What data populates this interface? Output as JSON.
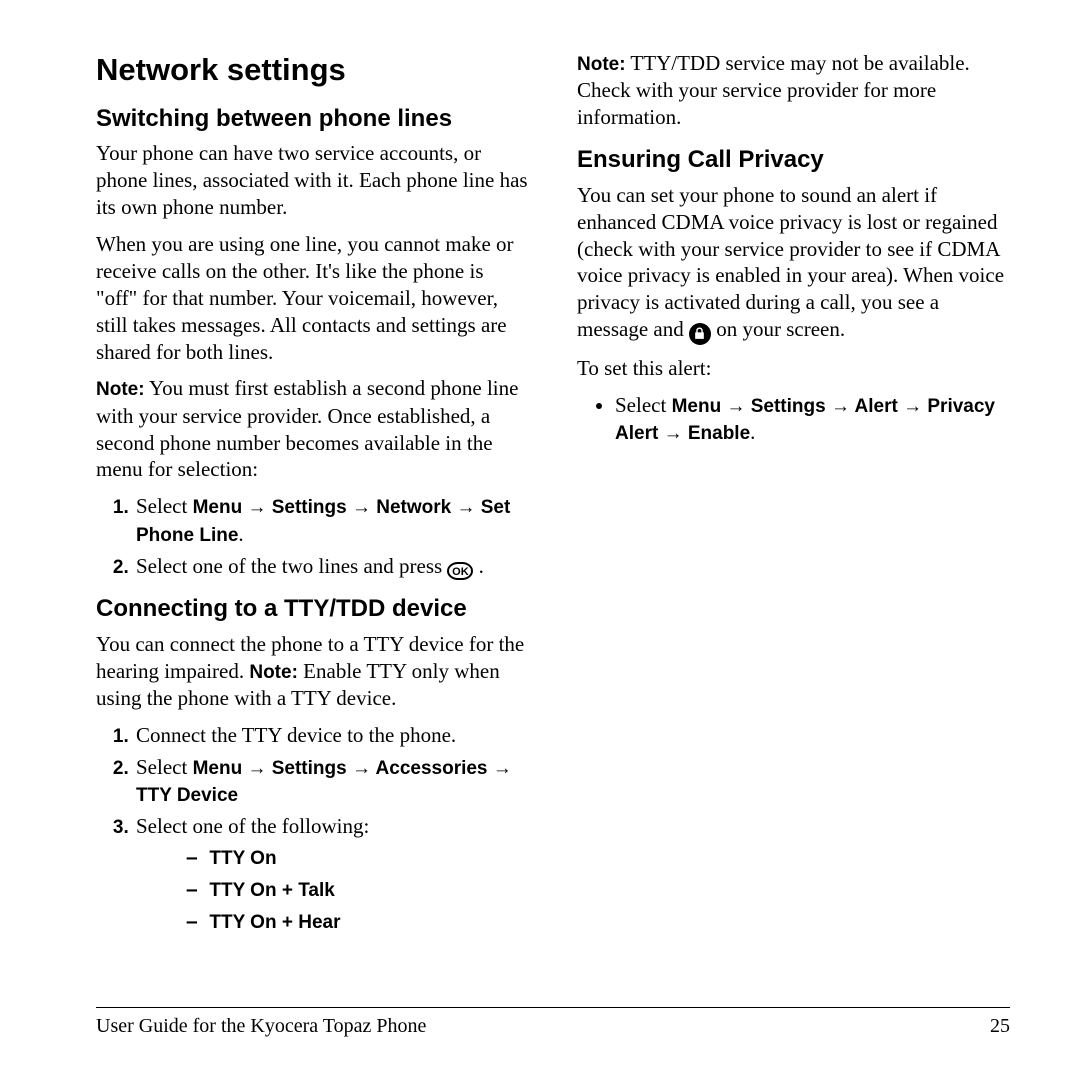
{
  "h1": "Network settings",
  "switching": {
    "heading": "Switching between phone lines",
    "p1": "Your phone can have two service accounts, or phone lines, associated with it. Each phone line has its own phone number.",
    "p2": "When you are using one line, you cannot make or receive calls on the other. It's like the phone is \"off\" for that number. Your voicemail, however, still takes messages. All contacts and settings are shared for both lines.",
    "note_label": "Note:",
    "note_body": " You must first establish a second phone line with your service provider. Once established, a second phone number becomes available in the menu for selection:",
    "ol1": {
      "pre": "Select ",
      "path": "Menu → Settings → Network → Set Phone Line",
      "post": "."
    },
    "ol2_pre": "Select one of the two lines and press ",
    "ol2_post": " .",
    "ok_text": "OK"
  },
  "tty": {
    "heading": "Connecting to a TTY/TDD device",
    "p1_pre": "You can connect the phone to a TTY device for the hearing impaired. ",
    "p1_note": "Note:",
    "p1_post": " Enable TTY only when using the phone with a TTY device.",
    "ol1": "Connect the TTY device to the phone.",
    "ol2": {
      "pre": "Select ",
      "path": "Menu → Settings → Accessories → TTY Device"
    },
    "ol3": "Select one of the following:",
    "opts": [
      "TTY On",
      "TTY On + Talk",
      "TTY On + Hear"
    ]
  },
  "tty_note": {
    "label": "Note:",
    "body": "  TTY/TDD service may not be available. Check with your service provider for more information."
  },
  "privacy": {
    "heading": "Ensuring Call Privacy",
    "p1_pre": "You can set your phone to sound an alert if enhanced CDMA voice privacy is lost or regained (check with your service provider to see if CDMA voice privacy is enabled in your area). When voice privacy is activated during a call, you see a message and ",
    "p1_post": " on your screen.",
    "p2": "To set this alert:",
    "bullet": {
      "pre": "Select ",
      "path": "Menu → Settings → Alert → Privacy Alert  → Enable",
      "post": "."
    }
  },
  "footer": {
    "left": "User Guide for the Kyocera Topaz Phone",
    "right": "25"
  }
}
